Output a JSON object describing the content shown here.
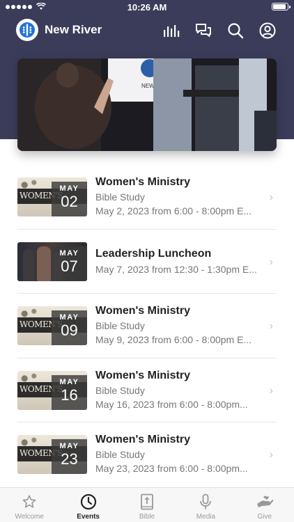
{
  "status_bar": {
    "time": "10:26 AM",
    "battery_level": 0.95
  },
  "app": {
    "title": "New River",
    "logo_icon": "new-river-logo"
  },
  "header_icons": [
    "stats-icon",
    "chat-icon",
    "search-icon",
    "profile-icon"
  ],
  "hero": {
    "screen_text": "NEW"
  },
  "events": [
    {
      "title": "Women's Ministry",
      "subtitle": "Bible Study",
      "date_text": "May 2, 2023 from 6:00 - 8:00pm E...",
      "month": "MAY",
      "day": "02",
      "thumb_text": "WOMEN'S",
      "thumb": "women"
    },
    {
      "title": "Leadership Luncheon",
      "subtitle": "",
      "date_text": "May 7, 2023 from 12:30 - 1:30pm E...",
      "month": "MAY",
      "day": "07",
      "thumb": "leader"
    },
    {
      "title": "Women's Ministry",
      "subtitle": "Bible Study",
      "date_text": "May 9, 2023 from 6:00 - 8:00pm E...",
      "month": "MAY",
      "day": "09",
      "thumb_text": "WOMEN'S",
      "thumb": "women"
    },
    {
      "title": "Women's Ministry",
      "subtitle": "Bible Study",
      "date_text": "May 16, 2023 from 6:00 - 8:00pm...",
      "month": "MAY",
      "day": "16",
      "thumb_text": "WOMEN'S",
      "thumb": "women"
    },
    {
      "title": "Women's Ministry",
      "subtitle": "Bible Study",
      "date_text": "May 23, 2023 from 6:00 - 8:00pm...",
      "month": "MAY",
      "day": "23",
      "thumb_text": "WOMEN'S",
      "thumb": "women"
    }
  ],
  "tabs": [
    {
      "label": "Welcome",
      "icon": "star-icon",
      "active": false
    },
    {
      "label": "Events",
      "icon": "clock-icon",
      "active": true
    },
    {
      "label": "Bible",
      "icon": "bible-icon",
      "active": false
    },
    {
      "label": "Media",
      "icon": "microphone-icon",
      "active": false
    },
    {
      "label": "Give",
      "icon": "give-hand-icon",
      "active": false
    }
  ],
  "colors": {
    "header": "#3b3c5a",
    "logo_blue": "#1f74d6",
    "tab_active": "#222222",
    "tab_inactive": "#999999"
  }
}
